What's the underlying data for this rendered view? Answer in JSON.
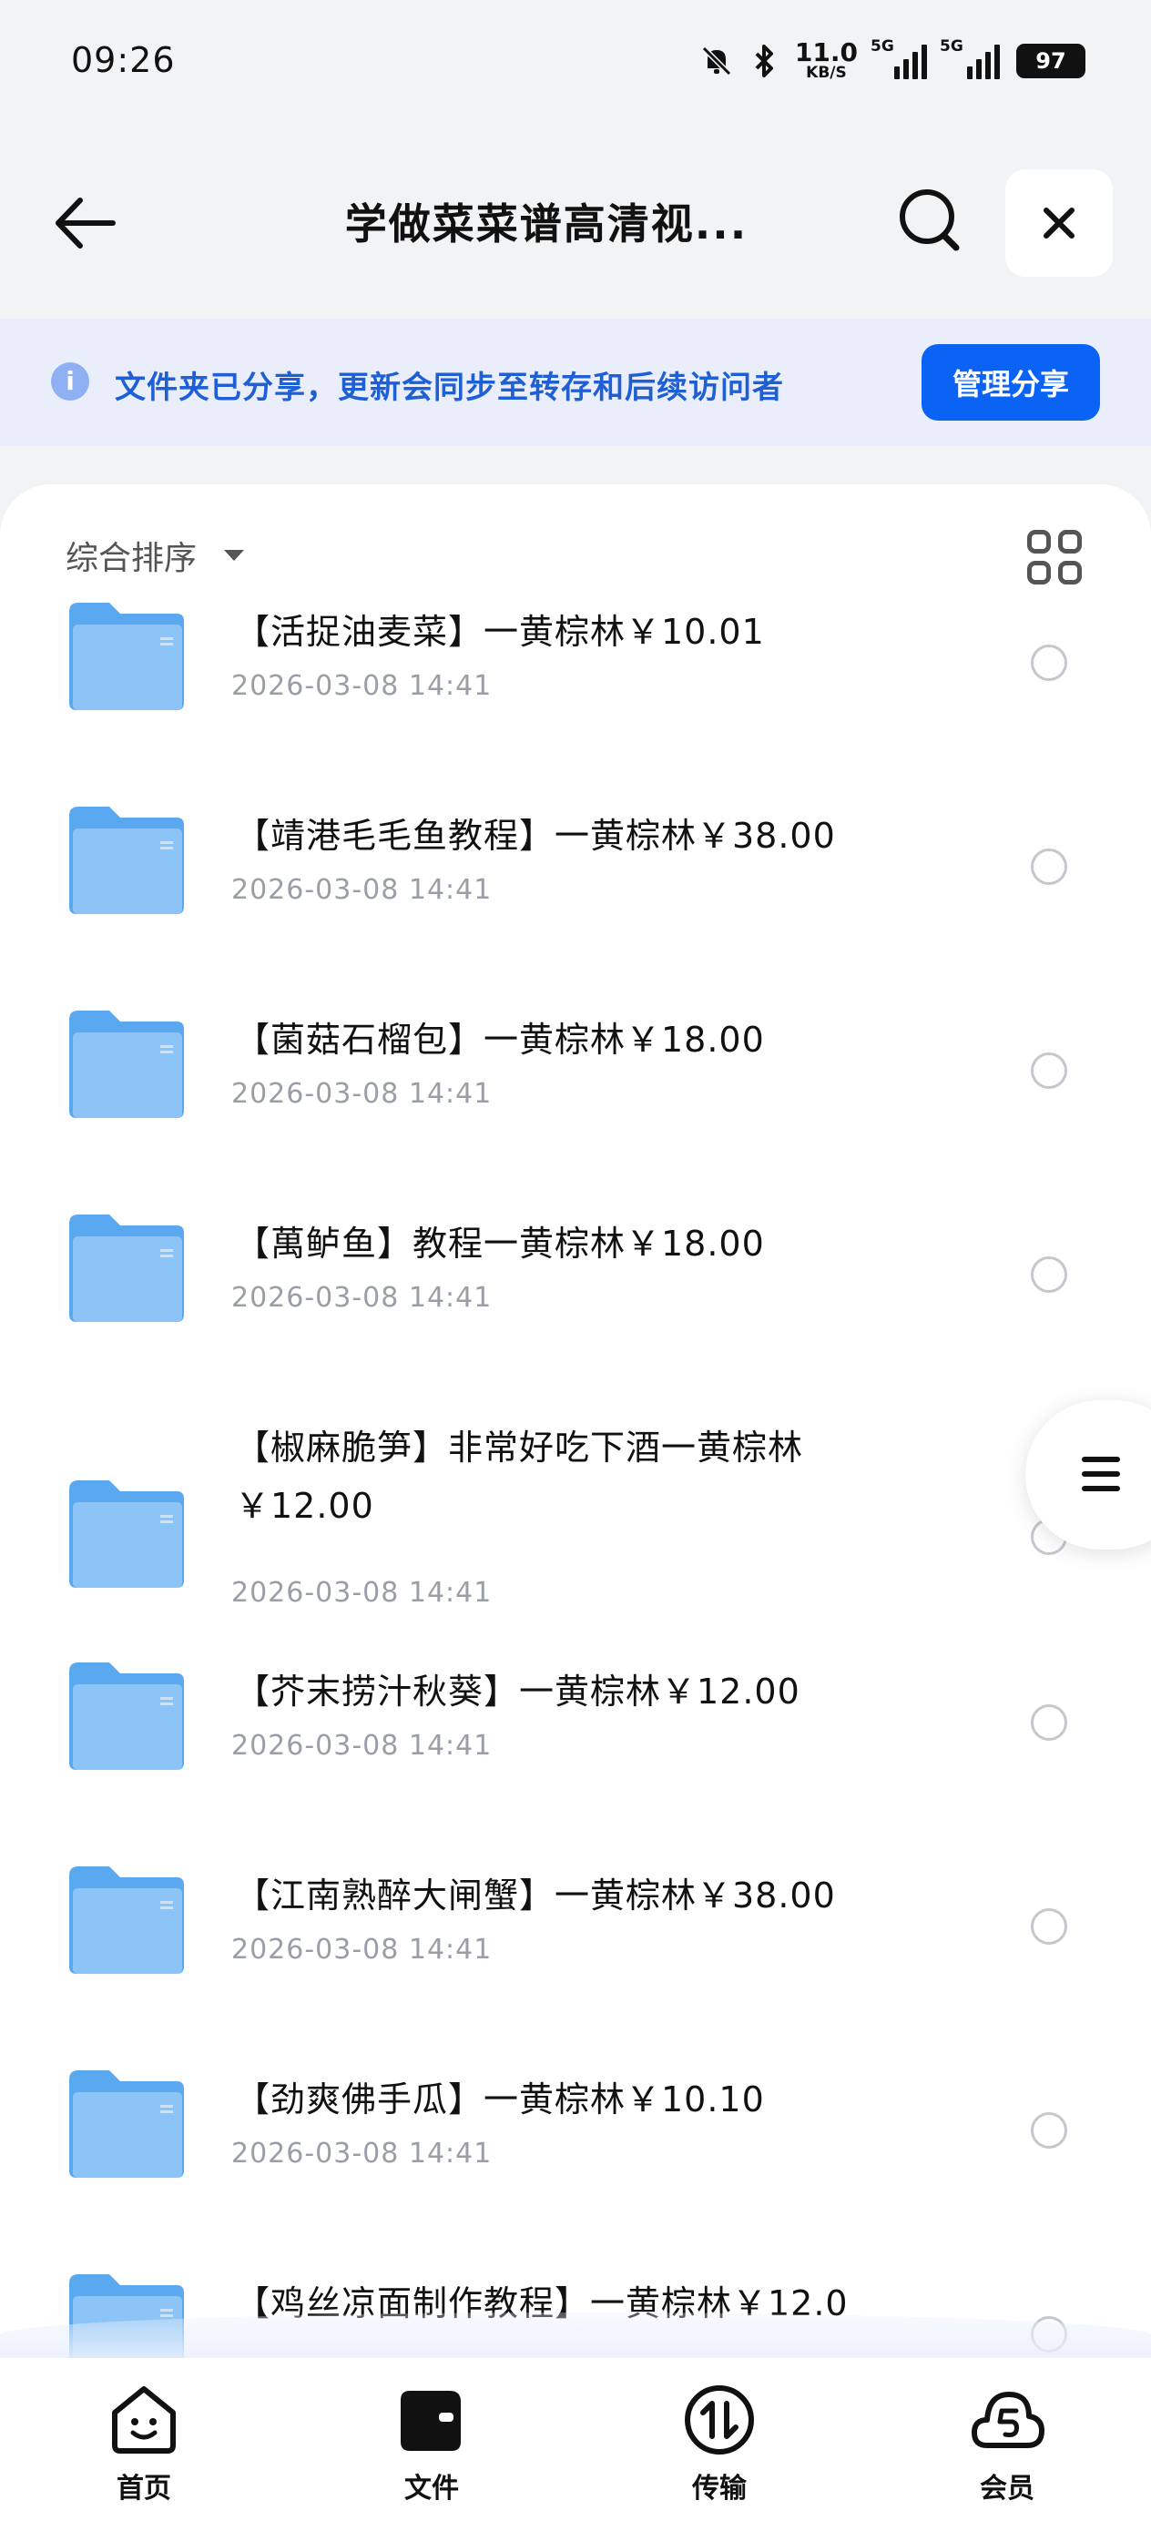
{
  "status_bar": {
    "time": "09:26",
    "net_speed_value": "11.0",
    "net_speed_unit": "KB/S",
    "sim1_label": "5G",
    "sim2_label": "5G",
    "battery": "97",
    "icons": [
      "mute-bell-icon",
      "bluetooth-icon",
      "signal-icon",
      "battery-icon"
    ]
  },
  "header": {
    "title": "学做菜菜谱高清视...",
    "back_icon": "arrow-left-icon",
    "search_icon": "search-icon",
    "close_icon": "close-icon"
  },
  "share_banner": {
    "text": "文件夹已分享，更新会同步至转存和后续访问者",
    "button_label": "管理分享",
    "accent": "#0b63f6"
  },
  "toolbar": {
    "sort_label": "综合排序",
    "view_toggle_icon": "grid-view-icon"
  },
  "files": [
    {
      "name": "【活捉油麦菜】一黄棕林￥10.01",
      "date": "2026-03-08 14:41"
    },
    {
      "name": "【靖港毛毛鱼教程】一黄棕林￥38.00",
      "date": "2026-03-08 14:41"
    },
    {
      "name": "【菌菇石榴包】一黄棕林￥18.00",
      "date": "2026-03-08 14:41"
    },
    {
      "name": "【萬鲈鱼】教程一黄棕林￥18.00",
      "date": "2026-03-08 14:41"
    },
    {
      "name": "【椒麻脆笋】非常好吃下酒一黄棕林￥12.00",
      "date": "2026-03-08 14:41"
    },
    {
      "name": "【芥末捞汁秋葵】一黄棕林￥12.00",
      "date": "2026-03-08 14:41"
    },
    {
      "name": "【江南熟醉大闸蟹】一黄棕林￥38.00",
      "date": "2026-03-08 14:41"
    },
    {
      "name": "【劲爽佛手瓜】一黄棕林￥10.10",
      "date": "2026-03-08 14:41"
    },
    {
      "name": "【鸡丝凉面制作教程】一黄棕林￥12.0",
      "date": ""
    }
  ],
  "bottom_nav": [
    {
      "label": "首页",
      "icon": "home-face-icon"
    },
    {
      "label": "文件",
      "icon": "folder-wallet-icon"
    },
    {
      "label": "传输",
      "icon": "transfer-icon"
    },
    {
      "label": "会员",
      "icon": "vip-cloud-icon"
    }
  ],
  "float_menu_icon": "menu-icon"
}
